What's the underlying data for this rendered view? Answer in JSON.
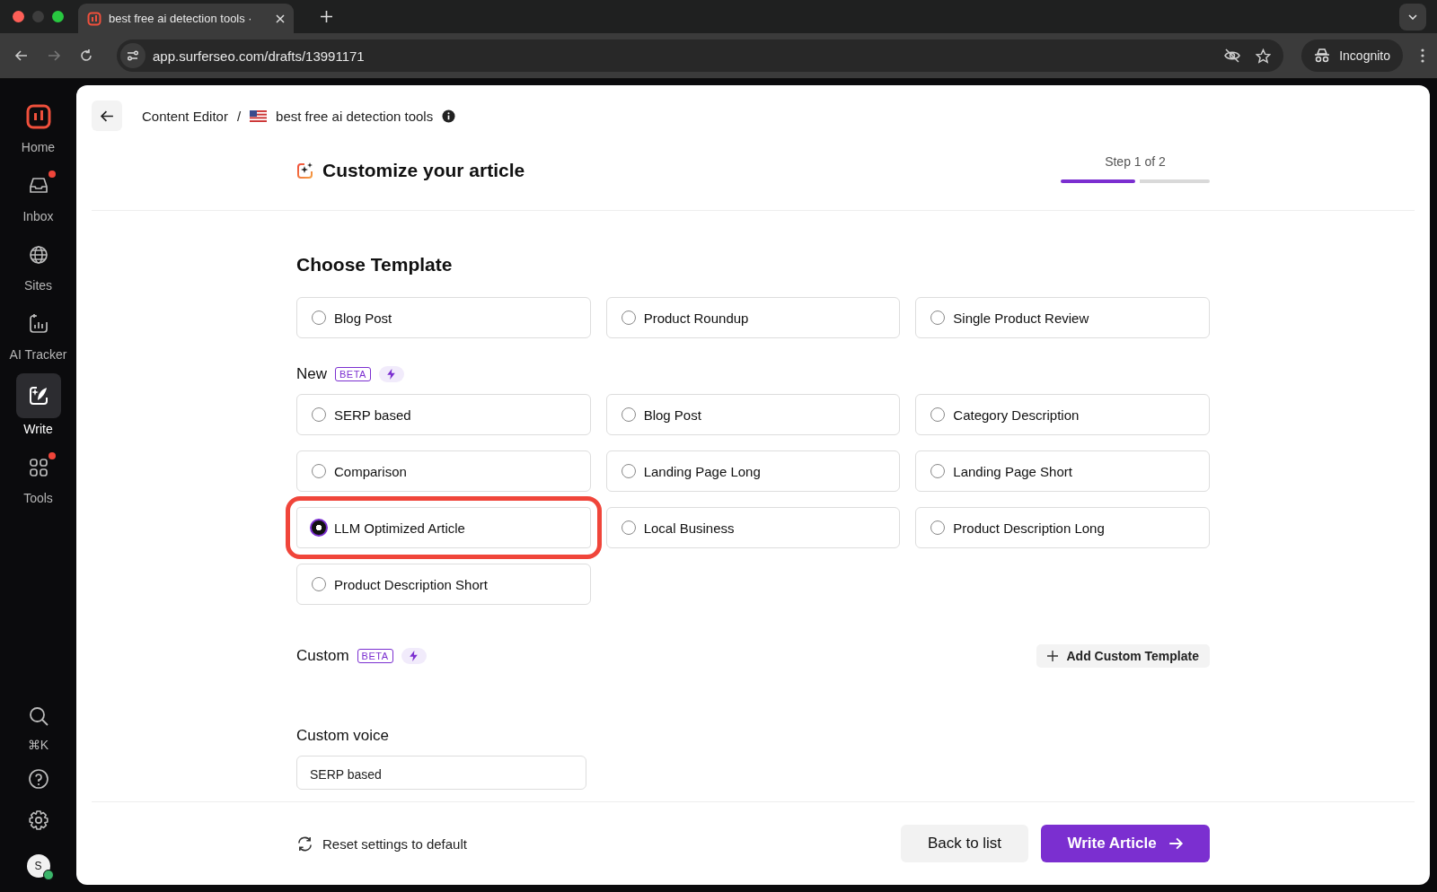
{
  "browser": {
    "tab_title": "best free ai detection tools ·",
    "url": "app.surferseo.com/drafts/13991171",
    "profile": "Incognito"
  },
  "sidebar": {
    "items": [
      {
        "label": "Home",
        "selected": false,
        "badge": false
      },
      {
        "label": "Inbox",
        "selected": false,
        "badge": true
      },
      {
        "label": "Sites",
        "selected": false,
        "badge": false
      },
      {
        "label": "AI Tracker",
        "selected": false,
        "badge": false
      },
      {
        "label": "Write",
        "selected": true,
        "badge": false
      },
      {
        "label": "Tools",
        "selected": false,
        "badge": true
      }
    ],
    "shortcut": "⌘K",
    "avatar": "S"
  },
  "breadcrumb": {
    "parent": "Content Editor",
    "separator": "/",
    "current": "best free ai detection tools"
  },
  "header": {
    "title": "Customize your article",
    "step": "Step 1 of 2",
    "level": 0.5
  },
  "sections": [
    {
      "title": "Choose Template",
      "options": [
        {
          "label": "Blog Post",
          "selected": false,
          "highlighted": false
        },
        {
          "label": "Product Roundup",
          "selected": false,
          "highlighted": false
        },
        {
          "label": "Single Product Review",
          "selected": false,
          "highlighted": false
        }
      ]
    },
    {
      "title": "New",
      "badge": "BETA",
      "options": [
        {
          "label": "SERP based",
          "selected": false,
          "highlighted": false
        },
        {
          "label": "Blog Post",
          "selected": false,
          "highlighted": false
        },
        {
          "label": "Category Description",
          "selected": false,
          "highlighted": false
        },
        {
          "label": "Comparison",
          "selected": false,
          "highlighted": false
        },
        {
          "label": "Landing Page Long",
          "selected": false,
          "highlighted": false
        },
        {
          "label": "Landing Page Short",
          "selected": false,
          "highlighted": false
        },
        {
          "label": "LLM Optimized Article",
          "selected": true,
          "highlighted": true
        },
        {
          "label": "Local Business",
          "selected": false,
          "highlighted": false
        },
        {
          "label": "Product Description Long",
          "selected": false,
          "highlighted": false
        },
        {
          "label": "Product Description Short",
          "selected": false,
          "highlighted": false
        }
      ]
    }
  ],
  "custom": {
    "title": "Custom",
    "badge": "BETA",
    "button": "Add Custom Template"
  },
  "custom_voice": {
    "title": "Custom voice",
    "value": "SERP based"
  },
  "footer": {
    "reset": "Reset settings to default",
    "back": "Back to list",
    "primary": "Write Article"
  }
}
